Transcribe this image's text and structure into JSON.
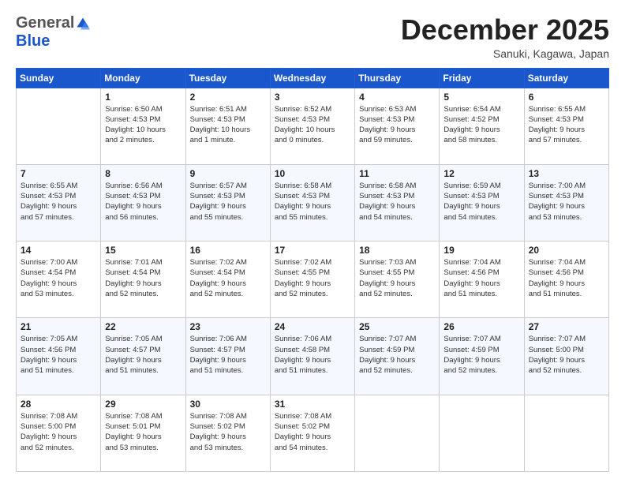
{
  "header": {
    "logo": {
      "general": "General",
      "blue": "Blue"
    },
    "title": "December 2025",
    "subtitle": "Sanuki, Kagawa, Japan"
  },
  "calendar": {
    "days_of_week": [
      "Sunday",
      "Monday",
      "Tuesday",
      "Wednesday",
      "Thursday",
      "Friday",
      "Saturday"
    ],
    "weeks": [
      [
        {
          "day": "",
          "info": ""
        },
        {
          "day": "1",
          "info": "Sunrise: 6:50 AM\nSunset: 4:53 PM\nDaylight: 10 hours\nand 2 minutes."
        },
        {
          "day": "2",
          "info": "Sunrise: 6:51 AM\nSunset: 4:53 PM\nDaylight: 10 hours\nand 1 minute."
        },
        {
          "day": "3",
          "info": "Sunrise: 6:52 AM\nSunset: 4:53 PM\nDaylight: 10 hours\nand 0 minutes."
        },
        {
          "day": "4",
          "info": "Sunrise: 6:53 AM\nSunset: 4:53 PM\nDaylight: 9 hours\nand 59 minutes."
        },
        {
          "day": "5",
          "info": "Sunrise: 6:54 AM\nSunset: 4:52 PM\nDaylight: 9 hours\nand 58 minutes."
        },
        {
          "day": "6",
          "info": "Sunrise: 6:55 AM\nSunset: 4:53 PM\nDaylight: 9 hours\nand 57 minutes."
        }
      ],
      [
        {
          "day": "7",
          "info": "Sunrise: 6:55 AM\nSunset: 4:53 PM\nDaylight: 9 hours\nand 57 minutes."
        },
        {
          "day": "8",
          "info": "Sunrise: 6:56 AM\nSunset: 4:53 PM\nDaylight: 9 hours\nand 56 minutes."
        },
        {
          "day": "9",
          "info": "Sunrise: 6:57 AM\nSunset: 4:53 PM\nDaylight: 9 hours\nand 55 minutes."
        },
        {
          "day": "10",
          "info": "Sunrise: 6:58 AM\nSunset: 4:53 PM\nDaylight: 9 hours\nand 55 minutes."
        },
        {
          "day": "11",
          "info": "Sunrise: 6:58 AM\nSunset: 4:53 PM\nDaylight: 9 hours\nand 54 minutes."
        },
        {
          "day": "12",
          "info": "Sunrise: 6:59 AM\nSunset: 4:53 PM\nDaylight: 9 hours\nand 54 minutes."
        },
        {
          "day": "13",
          "info": "Sunrise: 7:00 AM\nSunset: 4:53 PM\nDaylight: 9 hours\nand 53 minutes."
        }
      ],
      [
        {
          "day": "14",
          "info": "Sunrise: 7:00 AM\nSunset: 4:54 PM\nDaylight: 9 hours\nand 53 minutes."
        },
        {
          "day": "15",
          "info": "Sunrise: 7:01 AM\nSunset: 4:54 PM\nDaylight: 9 hours\nand 52 minutes."
        },
        {
          "day": "16",
          "info": "Sunrise: 7:02 AM\nSunset: 4:54 PM\nDaylight: 9 hours\nand 52 minutes."
        },
        {
          "day": "17",
          "info": "Sunrise: 7:02 AM\nSunset: 4:55 PM\nDaylight: 9 hours\nand 52 minutes."
        },
        {
          "day": "18",
          "info": "Sunrise: 7:03 AM\nSunset: 4:55 PM\nDaylight: 9 hours\nand 52 minutes."
        },
        {
          "day": "19",
          "info": "Sunrise: 7:04 AM\nSunset: 4:56 PM\nDaylight: 9 hours\nand 51 minutes."
        },
        {
          "day": "20",
          "info": "Sunrise: 7:04 AM\nSunset: 4:56 PM\nDaylight: 9 hours\nand 51 minutes."
        }
      ],
      [
        {
          "day": "21",
          "info": "Sunrise: 7:05 AM\nSunset: 4:56 PM\nDaylight: 9 hours\nand 51 minutes."
        },
        {
          "day": "22",
          "info": "Sunrise: 7:05 AM\nSunset: 4:57 PM\nDaylight: 9 hours\nand 51 minutes."
        },
        {
          "day": "23",
          "info": "Sunrise: 7:06 AM\nSunset: 4:57 PM\nDaylight: 9 hours\nand 51 minutes."
        },
        {
          "day": "24",
          "info": "Sunrise: 7:06 AM\nSunset: 4:58 PM\nDaylight: 9 hours\nand 51 minutes."
        },
        {
          "day": "25",
          "info": "Sunrise: 7:07 AM\nSunset: 4:59 PM\nDaylight: 9 hours\nand 52 minutes."
        },
        {
          "day": "26",
          "info": "Sunrise: 7:07 AM\nSunset: 4:59 PM\nDaylight: 9 hours\nand 52 minutes."
        },
        {
          "day": "27",
          "info": "Sunrise: 7:07 AM\nSunset: 5:00 PM\nDaylight: 9 hours\nand 52 minutes."
        }
      ],
      [
        {
          "day": "28",
          "info": "Sunrise: 7:08 AM\nSunset: 5:00 PM\nDaylight: 9 hours\nand 52 minutes."
        },
        {
          "day": "29",
          "info": "Sunrise: 7:08 AM\nSunset: 5:01 PM\nDaylight: 9 hours\nand 53 minutes."
        },
        {
          "day": "30",
          "info": "Sunrise: 7:08 AM\nSunset: 5:02 PM\nDaylight: 9 hours\nand 53 minutes."
        },
        {
          "day": "31",
          "info": "Sunrise: 7:08 AM\nSunset: 5:02 PM\nDaylight: 9 hours\nand 54 minutes."
        },
        {
          "day": "",
          "info": ""
        },
        {
          "day": "",
          "info": ""
        },
        {
          "day": "",
          "info": ""
        }
      ]
    ]
  }
}
